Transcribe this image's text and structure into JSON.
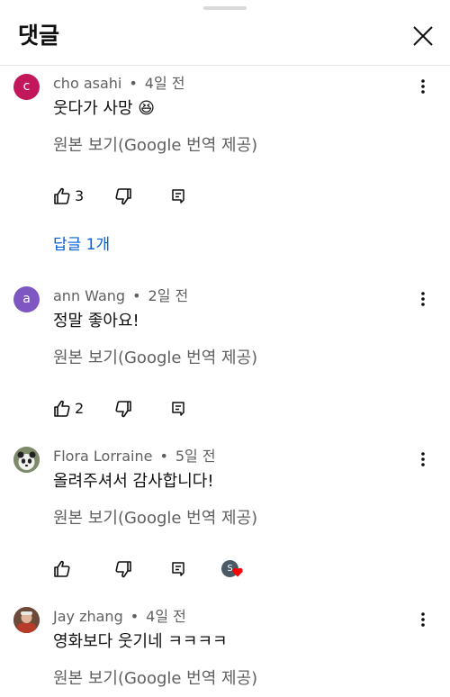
{
  "header": {
    "title": "댓글"
  },
  "comments": [
    {
      "avatar_letter": "c",
      "avatar_color": "#c2185b",
      "author": "cho asahi",
      "dot": "•",
      "time": "4일 전",
      "text": "웃다가 사망 😆",
      "translate": "원본 보기(Google 번역 제공)",
      "likes": "3",
      "replies": "답글 1개"
    },
    {
      "avatar_letter": "a",
      "avatar_color": "#7e57c2",
      "author": "ann Wang",
      "dot": "•",
      "time": "2일 전",
      "text": "정말 좋아요!",
      "translate": "원본 보기(Google 번역 제공)",
      "likes": "2"
    },
    {
      "avatar_letter": "",
      "avatar_color": "#9e9e9e",
      "author": "Flora Lorraine",
      "dot": "•",
      "time": "5일 전",
      "text": "올려주셔서 감사합니다!",
      "translate": "원본 보기(Google 번역 제공)",
      "likes": "",
      "creator_heart_letter": "S"
    },
    {
      "avatar_letter": "",
      "avatar_color": "#8d4a3a",
      "author": "Jay zhang",
      "dot": "•",
      "time": "4일 전",
      "text": "영화보다 웃기네 ㅋㅋㅋㅋ",
      "translate": "원본 보기(Google 번역 제공)"
    }
  ],
  "colors": {
    "link": "#065fd4",
    "secondary_text": "#606060",
    "heart": "#ff0000"
  }
}
